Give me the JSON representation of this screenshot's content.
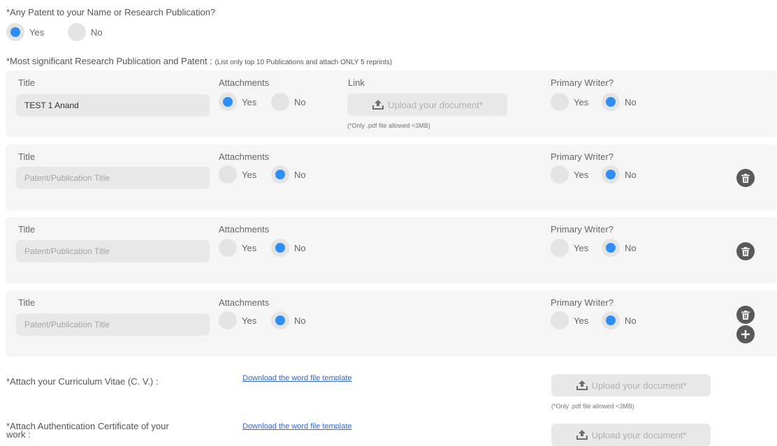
{
  "patent_question": {
    "label": "*Any Patent to your Name or Research Publication?",
    "yes": "Yes",
    "no": "No",
    "selected": "yes"
  },
  "publications_section": {
    "label": "*Most significant Research Publication and Patent :",
    "note": "(List only top 10 Publications and attach ONLY 5 reprints)"
  },
  "columns": {
    "title": "Title",
    "attachments": "Attachments",
    "link": "Link",
    "primary_writer": "Primary Writer?"
  },
  "radio_labels": {
    "yes": "Yes",
    "no": "No"
  },
  "rows": [
    {
      "title_value": "TEST 1 Anand",
      "title_placeholder": "Patent/Publication Title",
      "attachments": "yes",
      "primary_writer": "no",
      "upload_label": "Upload your document*",
      "upload_hint": "(*Only .pdf file allowed <3MB)"
    },
    {
      "title_value": "",
      "title_placeholder": "Patent/Publication Title",
      "attachments": "no",
      "primary_writer": "no"
    },
    {
      "title_value": "",
      "title_placeholder": "Patent/Publication Title",
      "attachments": "no",
      "primary_writer": "no"
    },
    {
      "title_value": "",
      "title_placeholder": "Patent/Publication Title",
      "attachments": "no",
      "primary_writer": "no"
    }
  ],
  "icons": {
    "delete": "trash-icon",
    "add": "plus-icon",
    "upload": "upload-icon"
  },
  "cv": {
    "label": "*Attach your Curriculum Vitae (C. V.) :",
    "download_link": "Download the word file template",
    "upload_label": "Upload your document*",
    "upload_hint": "(*Only .pdf file allowed <3MB)"
  },
  "auth": {
    "label_line1": "*Attach Authentication Certificate of your",
    "label_line2": "work :",
    "download_link": "Download the word file template",
    "upload_label": "Upload your document*"
  },
  "colors": {
    "accent": "#2f8ef3",
    "card_bg": "#f5f5f5",
    "input_bg": "#e8e8e8",
    "icon_bg": "#595959",
    "link": "#3366cc"
  }
}
